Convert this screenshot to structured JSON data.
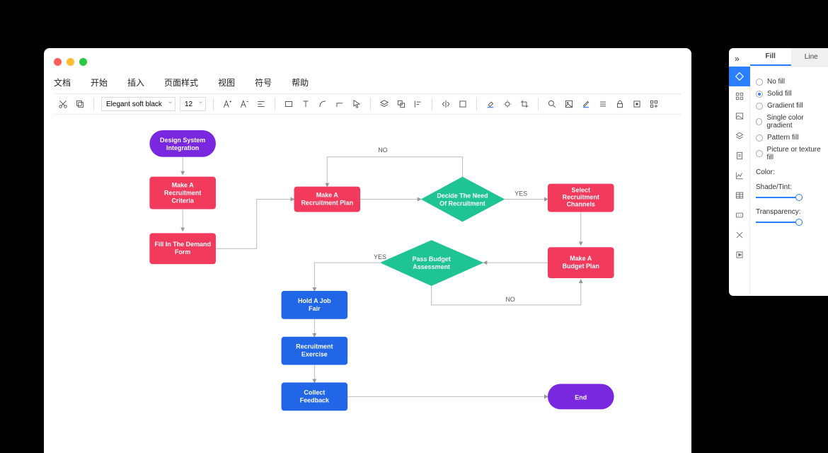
{
  "menus": [
    "文档",
    "开始",
    "插入",
    "页面样式",
    "视图",
    "符号",
    "帮助"
  ],
  "font": {
    "name": "Elegant soft black",
    "size": "12"
  },
  "nodes": {
    "start": "Design System\nIntegration",
    "criteria": "Make A\nRecruitment\nCriteria",
    "demand": "Fill In The Demand\nForm",
    "plan": "Make A\nRecruitment Plan",
    "decideNeed": "Decide The Need\nOf Recruitment",
    "channels": "Select\nRecruitment\nChannels",
    "budget": "Make A\nBudget Plan",
    "passBudget": "Pass Budget\nAssessment",
    "fair": "Hold A Job\nFair",
    "exercise": "Recruitment\nExercise",
    "feedback": "Collect\nFeedback",
    "end": "End"
  },
  "edges": {
    "no": "NO",
    "yes": "YES",
    "no2": "NO",
    "yes2": "YES"
  },
  "panel": {
    "tabs": {
      "fill": "Fill",
      "line": "Line"
    },
    "fillOptions": [
      "No fill",
      "Solid fill",
      "Gradient fill",
      "Single color gradient",
      "Pattern fill",
      "Picture or texture fill"
    ],
    "selectedFill": 1,
    "labels": {
      "color": "Color:",
      "shade": "Shade/Tint:",
      "transparency": "Transparency:"
    }
  }
}
